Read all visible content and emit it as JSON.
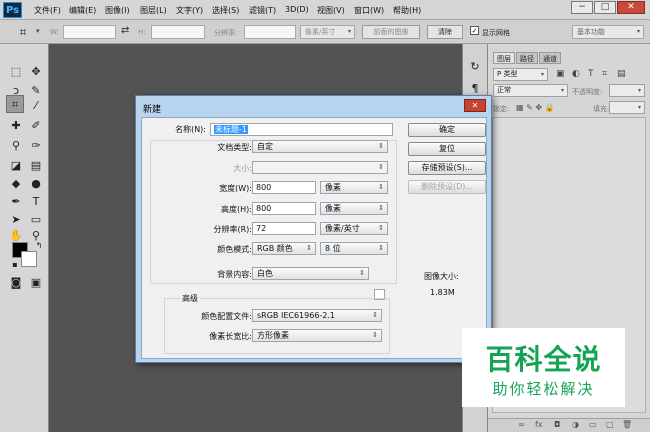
{
  "app": {
    "logo": "Ps"
  },
  "menubar": {
    "items": [
      "文件(F)",
      "编辑(E)",
      "图像(I)",
      "图层(L)",
      "文字(Y)",
      "选择(S)",
      "滤镜(T)",
      "3D(D)",
      "视图(V)",
      "窗口(W)",
      "帮助(H)"
    ],
    "window_buttons": {
      "minimize": "−",
      "maximize": "□",
      "close": "✕"
    }
  },
  "optionsbar": {
    "w_label": "W:",
    "h_label": "H:",
    "resolution_label": "分辨率:",
    "unit_select": "像素/英寸",
    "front_image_button": "前面的图像",
    "clear_button": "清除",
    "show_grid_label": "显示网格",
    "workspace_select": "基本功能"
  },
  "layers_panel": {
    "tabs": [
      "图层",
      "路径",
      "通道"
    ],
    "filter_select": "P 类型",
    "blend_mode": "正常",
    "opacity_label": "不透明度:",
    "lock_label": "锁定:",
    "fill_label": "填充:"
  },
  "dialog": {
    "title": "新建",
    "close_icon": "✕",
    "name_label": "名称(N):",
    "name_value": "未标题-1",
    "preset_label": "文档类型:",
    "preset_value": "自定",
    "size_label": "大小:",
    "size_value": "",
    "width_label": "宽度(W):",
    "width_value": "800",
    "width_unit": "像素",
    "height_label": "高度(H):",
    "height_value": "800",
    "height_unit": "像素",
    "resolution_label": "分辨率(R):",
    "resolution_value": "72",
    "resolution_unit": "像素/英寸",
    "color_mode_label": "颜色模式:",
    "color_mode_value": "RGB 颜色",
    "bit_depth_value": "8 位",
    "background_label": "背景内容:",
    "background_value": "白色",
    "advanced_label": "高级",
    "color_profile_label": "颜色配置文件:",
    "color_profile_value": "sRGB IEC61966-2.1",
    "pixel_aspect_label": "像素长宽比:",
    "pixel_aspect_value": "方形像素",
    "buttons": {
      "ok": "确定",
      "reset": "复位",
      "save_preset": "存储预设(S)...",
      "delete_preset": "删除预设(D)..."
    },
    "image_size_label": "图像大小:",
    "image_size_value": "1.83M"
  },
  "watermark": {
    "main": "百科全说",
    "sub": "助你轻松解决"
  },
  "colors": {
    "dialog_frame": "#b9d4ee",
    "selection": "#3399ff",
    "watermark_green": "#15a355",
    "workspace_bg": "#535353"
  }
}
